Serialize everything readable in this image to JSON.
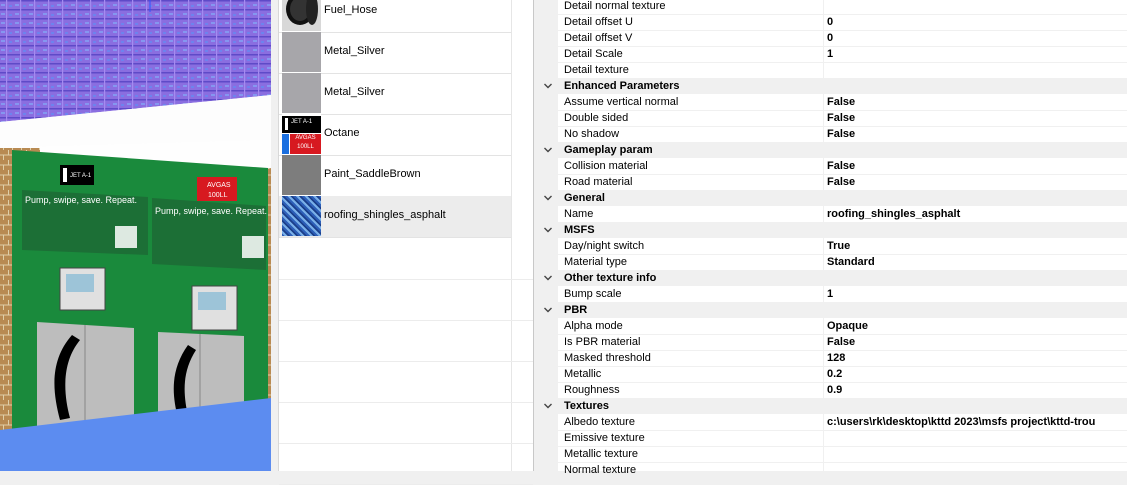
{
  "materials": [
    {
      "name": "Fuel_Hose",
      "thumb": "hose"
    },
    {
      "name": "Metal_Silver",
      "thumb": "gray"
    },
    {
      "name": "Metal_Silver",
      "thumb": "gray"
    },
    {
      "name": "Octane",
      "thumb": "octane"
    },
    {
      "name": "Paint_SaddleBrown",
      "thumb": "darkgray"
    },
    {
      "name": "roofing_shingles_asphalt",
      "thumb": "shingles",
      "selected": true
    }
  ],
  "thumb_labels": {
    "jet": "JET A-1",
    "avgas": "AVGAS 100LL"
  },
  "viewport": {
    "jet_sign": "JET A-1",
    "avgas_sign_1": "AVGAS",
    "avgas_sign_2": "100LL",
    "banner_text": "Pump, swipe, save. Repeat.",
    "colors": {
      "roof": "#8a6ee0",
      "pump": "#1a8a3c",
      "brick": "#b88a52"
    }
  },
  "properties": [
    {
      "name": "Detail normal texture",
      "value": ""
    },
    {
      "name": "Detail offset U",
      "value": "0"
    },
    {
      "name": "Detail offset V",
      "value": "0"
    },
    {
      "name": "Detail Scale",
      "value": "1"
    },
    {
      "name": "Detail texture",
      "value": ""
    },
    {
      "group": "Enhanced Parameters"
    },
    {
      "name": "Assume vertical normal",
      "value": "False"
    },
    {
      "name": "Double sided",
      "value": "False"
    },
    {
      "name": "No shadow",
      "value": "False"
    },
    {
      "group": "Gameplay param"
    },
    {
      "name": "Collision material",
      "value": "False"
    },
    {
      "name": "Road material",
      "value": "False"
    },
    {
      "group": "General"
    },
    {
      "name": "Name",
      "value": "roofing_shingles_asphalt"
    },
    {
      "group": "MSFS"
    },
    {
      "name": "Day/night switch",
      "value": "True"
    },
    {
      "name": "Material type",
      "value": "Standard"
    },
    {
      "group": "Other texture info"
    },
    {
      "name": "Bump scale",
      "value": "1"
    },
    {
      "group": "PBR"
    },
    {
      "name": "Alpha mode",
      "value": "Opaque"
    },
    {
      "name": "Is PBR material",
      "value": "False"
    },
    {
      "name": "Masked threshold",
      "value": "128"
    },
    {
      "name": "Metallic",
      "value": "0.2"
    },
    {
      "name": "Roughness",
      "value": "0.9"
    },
    {
      "group": "Textures"
    },
    {
      "name": "Albedo texture",
      "value": "c:\\users\\rk\\desktop\\kttd 2023\\msfs project\\kttd-trou"
    },
    {
      "name": "Emissive texture",
      "value": ""
    },
    {
      "name": "Metallic texture",
      "value": ""
    },
    {
      "name": "Normal texture",
      "value": ""
    }
  ]
}
